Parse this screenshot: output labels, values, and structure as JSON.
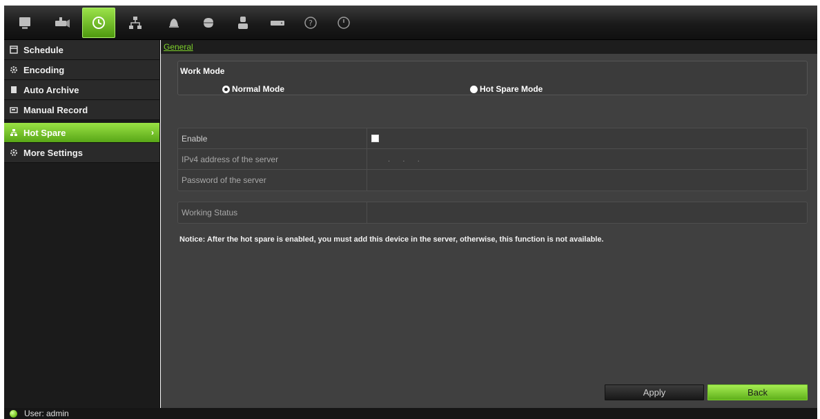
{
  "toolbar": {
    "icons": [
      "monitor-icon",
      "camera-icon",
      "recording-clock-icon",
      "network-icon",
      "alarm-bell-icon",
      "ptz-dome-icon",
      "user-icon",
      "hdd-icon",
      "help-icon",
      "power-icon"
    ],
    "active_index": 2
  },
  "sidebar": {
    "items": [
      {
        "label": "Schedule",
        "icon": "schedule-icon"
      },
      {
        "label": "Encoding",
        "icon": "encoding-icon"
      },
      {
        "label": "Auto Archive",
        "icon": "archive-icon"
      },
      {
        "label": "Manual Record",
        "icon": "manual-record-icon"
      },
      {
        "label": "Hot Spare",
        "icon": "hot-spare-icon",
        "active": true
      },
      {
        "label": "More Settings",
        "icon": "more-settings-icon"
      }
    ],
    "chevron": "›"
  },
  "tab": {
    "general": "General"
  },
  "work_mode": {
    "title": "Work Mode",
    "normal": "Normal Mode",
    "hot_spare": "Hot Spare Mode",
    "selected": "normal"
  },
  "settings": {
    "enable_label": "Enable",
    "enable_checked": false,
    "ipv4_label": "IPv4 address of the server",
    "ipv4_value": ".      .      .",
    "password_label": "Password of the server",
    "password_value": "",
    "working_status_label": "Working Status",
    "working_status_value": ""
  },
  "notice": "Notice: After the hot spare is enabled, you must add this device in the server, otherwise, this function is not available.",
  "buttons": {
    "apply": "Apply",
    "back": "Back"
  },
  "status": {
    "user": "User: admin"
  },
  "colors": {
    "accent": "#7fd32c",
    "panel": "#404040",
    "sidebar": "#1b1b1b"
  }
}
